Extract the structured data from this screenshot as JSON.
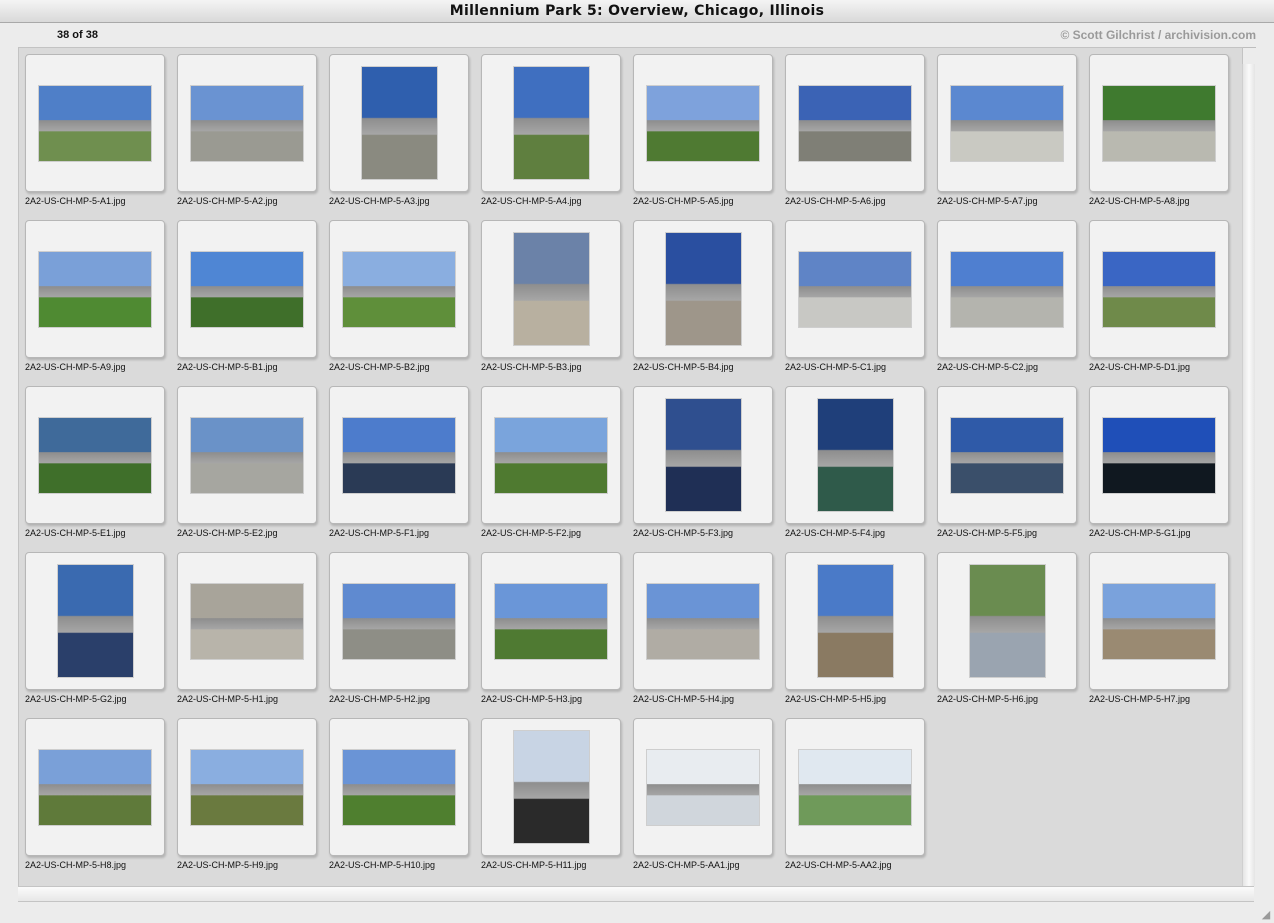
{
  "window": {
    "title": "Millennium Park 5: Overview, Chicago, Illinois"
  },
  "info": {
    "count": "38 of 38",
    "credit": "© Scott Gilchrist / archivision.com"
  },
  "thumbnails": [
    {
      "name": "2A2-US-CH-MP-5-A1.jpg",
      "orientation": "landscape",
      "sky": "#4f7fc8",
      "ground": "#6f8f4f"
    },
    {
      "name": "2A2-US-CH-MP-5-A2.jpg",
      "orientation": "landscape",
      "sky": "#6a93d2",
      "ground": "#9a9a92"
    },
    {
      "name": "2A2-US-CH-MP-5-A3.jpg",
      "orientation": "portrait",
      "sky": "#2f5fae",
      "ground": "#8a8a80"
    },
    {
      "name": "2A2-US-CH-MP-5-A4.jpg",
      "orientation": "portrait",
      "sky": "#3f6fc0",
      "ground": "#5f7f3f"
    },
    {
      "name": "2A2-US-CH-MP-5-A5.jpg",
      "orientation": "landscape",
      "sky": "#7ea2dc",
      "ground": "#4f7a32"
    },
    {
      "name": "2A2-US-CH-MP-5-A6.jpg",
      "orientation": "landscape",
      "sky": "#3b63b5",
      "ground": "#7f7f76"
    },
    {
      "name": "2A2-US-CH-MP-5-A7.jpg",
      "orientation": "landscape",
      "sky": "#5b88d0",
      "ground": "#c9c9c2"
    },
    {
      "name": "2A2-US-CH-MP-5-A8.jpg",
      "orientation": "landscape",
      "sky": "#3f7a2f",
      "ground": "#b9b9b0"
    },
    {
      "name": "2A2-US-CH-MP-5-A9.jpg",
      "orientation": "landscape",
      "sky": "#7aa0d8",
      "ground": "#4f8a32"
    },
    {
      "name": "2A2-US-CH-MP-5-B1.jpg",
      "orientation": "landscape",
      "sky": "#4f86d4",
      "ground": "#3f6f2a"
    },
    {
      "name": "2A2-US-CH-MP-5-B2.jpg",
      "orientation": "landscape",
      "sky": "#8aaee0",
      "ground": "#5f8f3a"
    },
    {
      "name": "2A2-US-CH-MP-5-B3.jpg",
      "orientation": "portrait",
      "sky": "#6b82a8",
      "ground": "#b8b0a0"
    },
    {
      "name": "2A2-US-CH-MP-5-B4.jpg",
      "orientation": "portrait",
      "sky": "#2a4fa0",
      "ground": "#9e968a"
    },
    {
      "name": "2A2-US-CH-MP-5-C1.jpg",
      "orientation": "landscape",
      "sky": "#5f84c6",
      "ground": "#c8c8c4"
    },
    {
      "name": "2A2-US-CH-MP-5-C2.jpg",
      "orientation": "landscape",
      "sky": "#4f7fd0",
      "ground": "#b4b4ae"
    },
    {
      "name": "2A2-US-CH-MP-5-D1.jpg",
      "orientation": "landscape",
      "sky": "#3a66c4",
      "ground": "#6f8a4a"
    },
    {
      "name": "2A2-US-CH-MP-5-E1.jpg",
      "orientation": "landscape",
      "sky": "#3f6a9a",
      "ground": "#3f6f2a"
    },
    {
      "name": "2A2-US-CH-MP-5-E2.jpg",
      "orientation": "landscape",
      "sky": "#6a92c8",
      "ground": "#a6a6a0"
    },
    {
      "name": "2A2-US-CH-MP-5-F1.jpg",
      "orientation": "landscape",
      "sky": "#4d7ccc",
      "ground": "#2a3a55"
    },
    {
      "name": "2A2-US-CH-MP-5-F2.jpg",
      "orientation": "landscape",
      "sky": "#7aa4dc",
      "ground": "#4f7a30"
    },
    {
      "name": "2A2-US-CH-MP-5-F3.jpg",
      "orientation": "portrait",
      "sky": "#2f4f8f",
      "ground": "#1f2f55"
    },
    {
      "name": "2A2-US-CH-MP-5-F4.jpg",
      "orientation": "portrait",
      "sky": "#1f3f7a",
      "ground": "#2f5a4a"
    },
    {
      "name": "2A2-US-CH-MP-5-F5.jpg",
      "orientation": "landscape",
      "sky": "#2f5aa8",
      "ground": "#3a4f6a"
    },
    {
      "name": "2A2-US-CH-MP-5-G1.jpg",
      "orientation": "landscape",
      "sky": "#1f4fb8",
      "ground": "#101820"
    },
    {
      "name": "2A2-US-CH-MP-5-G2.jpg",
      "orientation": "portrait",
      "sky": "#3a6ab0",
      "ground": "#2a3f6a"
    },
    {
      "name": "2A2-US-CH-MP-5-H1.jpg",
      "orientation": "landscape",
      "sky": "#a8a49a",
      "ground": "#b8b4aa"
    },
    {
      "name": "2A2-US-CH-MP-5-H2.jpg",
      "orientation": "landscape",
      "sky": "#5f8ad0",
      "ground": "#8e8e86"
    },
    {
      "name": "2A2-US-CH-MP-5-H3.jpg",
      "orientation": "landscape",
      "sky": "#6a96d8",
      "ground": "#4f7a32"
    },
    {
      "name": "2A2-US-CH-MP-5-H4.jpg",
      "orientation": "landscape",
      "sky": "#6a94d6",
      "ground": "#b0aca4"
    },
    {
      "name": "2A2-US-CH-MP-5-H5.jpg",
      "orientation": "portrait",
      "sky": "#4a7ac8",
      "ground": "#8a7a62"
    },
    {
      "name": "2A2-US-CH-MP-5-H6.jpg",
      "orientation": "portrait",
      "sky": "#6a8c50",
      "ground": "#9aa4b0"
    },
    {
      "name": "2A2-US-CH-MP-5-H7.jpg",
      "orientation": "landscape",
      "sky": "#7aa2dc",
      "ground": "#9a8a72"
    },
    {
      "name": "2A2-US-CH-MP-5-H8.jpg",
      "orientation": "landscape",
      "sky": "#7aa0d8",
      "ground": "#5f7a3a"
    },
    {
      "name": "2A2-US-CH-MP-5-H9.jpg",
      "orientation": "landscape",
      "sky": "#8aaee0",
      "ground": "#6a7a3f"
    },
    {
      "name": "2A2-US-CH-MP-5-H10.jpg",
      "orientation": "landscape",
      "sky": "#6a94d6",
      "ground": "#4f7f2f"
    },
    {
      "name": "2A2-US-CH-MP-5-H11.jpg",
      "orientation": "portrait",
      "sky": "#c8d4e4",
      "ground": "#2a2a2a"
    },
    {
      "name": "2A2-US-CH-MP-5-AA1.jpg",
      "orientation": "landscape",
      "sky": "#e8ecf0",
      "ground": "#d0d6dc"
    },
    {
      "name": "2A2-US-CH-MP-5-AA2.jpg",
      "orientation": "landscape",
      "sky": "#e0e8f0",
      "ground": "#6f9a5a"
    }
  ]
}
